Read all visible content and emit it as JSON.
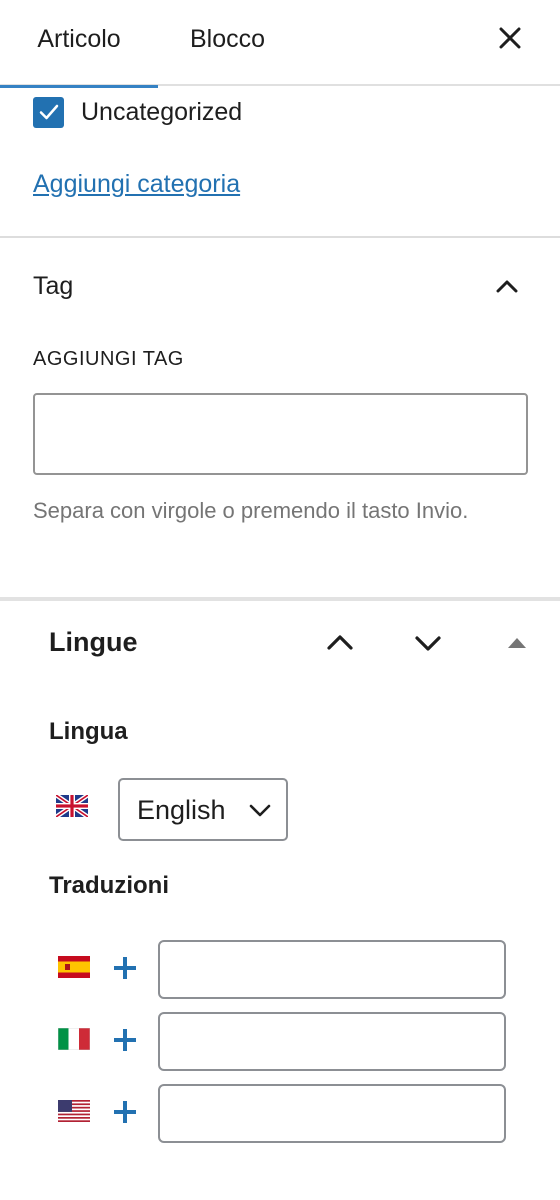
{
  "tabs": [
    {
      "label": "Articolo",
      "active": true
    },
    {
      "label": "Blocco",
      "active": false
    }
  ],
  "categories": {
    "items": [
      {
        "label": "Uncategorized",
        "checked": true
      }
    ],
    "add_link": "Aggiungi categoria"
  },
  "tags": {
    "title": "Tag",
    "field_label": "AGGIUNGI TAG",
    "input_value": "",
    "help_text": "Separa con virgole o premendo il tasto Invio."
  },
  "languages": {
    "title": "Lingue",
    "language_label": "Lingua",
    "selected_language": "English",
    "selected_flag": "uk-flag-icon",
    "translations_label": "Traduzioni",
    "translations": [
      {
        "flag": "spain-flag-icon",
        "value": ""
      },
      {
        "flag": "italy-flag-icon",
        "value": ""
      },
      {
        "flag": "usa-flag-icon",
        "value": ""
      }
    ]
  },
  "colors": {
    "accent": "#2271b1",
    "tab_indicator": "#3582c4",
    "help_text": "#757575"
  }
}
